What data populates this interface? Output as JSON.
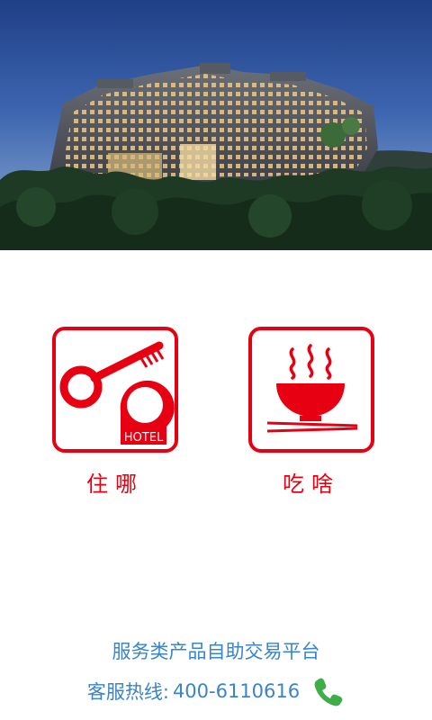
{
  "hero": {
    "image": "hotel-building-night-photo"
  },
  "tiles": [
    {
      "label": "住哪",
      "icon": "hotel-key-icon",
      "icon_text": "HOTEL"
    },
    {
      "label": "吃啥",
      "icon": "noodle-bowl-icon"
    }
  ],
  "footer": {
    "platform": "服务类产品自助交易平台",
    "hotline_label": "客服热线:",
    "hotline_number": "400-6110616",
    "phone_icon": "phone-icon"
  },
  "colors": {
    "accent": "#e60012",
    "footer_text": "#3a84c8",
    "phone": "#3fae49"
  }
}
